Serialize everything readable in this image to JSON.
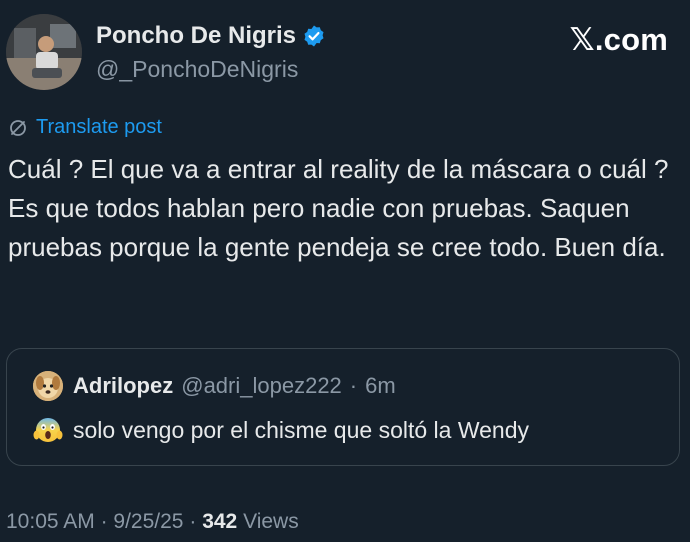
{
  "brand": "𝕏.com",
  "author": {
    "display_name": "Poncho De Nigris",
    "handle": "@_PonchoDeNigris",
    "verified": true,
    "verified_color": "#1d9bf0"
  },
  "translate": {
    "label": "Translate post",
    "icon": "translate-icon"
  },
  "post": {
    "text": "Cuál ? El que va a entrar al reality de la máscara o cuál ? Es que todos hablan pero nadie con pruebas. Saquen pruebas porque la gente pendeja se cree todo.  Buen día."
  },
  "quoted": {
    "display_name": "Adrilopez",
    "handle": "@adri_lopez222",
    "separator": "·",
    "age": "6m",
    "emoji": "face-screaming-in-fear-emoji",
    "text": "solo vengo por el chisme que soltó la Wendy"
  },
  "footer": {
    "time": "10:05 AM",
    "sep1": "·",
    "date": "9/25/25",
    "sep2": "·",
    "views_count": "342",
    "views_label": "Views"
  },
  "colors": {
    "background": "#15202b",
    "text": "#e7e9ea",
    "muted": "#8b98a5",
    "link": "#1d9bf0",
    "border": "#38444d"
  }
}
